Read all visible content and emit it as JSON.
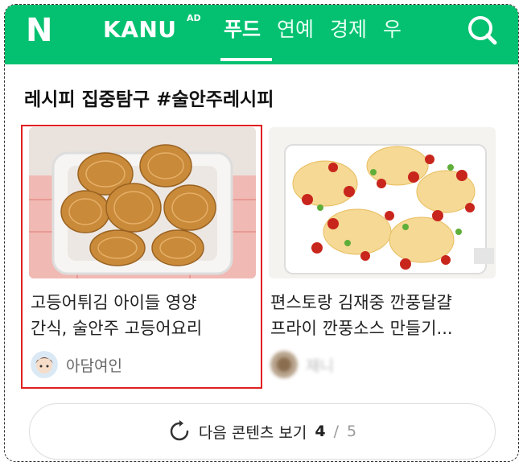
{
  "header": {
    "logo": "N",
    "brand": "KANU",
    "brand_sup": "AD",
    "nav": [
      {
        "label": "푸드",
        "active": true
      },
      {
        "label": "연예",
        "active": false
      },
      {
        "label": "경제",
        "active": false
      },
      {
        "label": "우",
        "active": false
      }
    ],
    "search_icon": "search-icon",
    "colors": {
      "brand_green": "#03c170"
    }
  },
  "section": {
    "title": "레시피 집중탐구 #술안주레시피"
  },
  "cards": [
    {
      "title_line1": "고등어튀김 아이들 영양",
      "title_line2": "간식, 술안주 고등어요리",
      "author": "아담여인",
      "highlighted": true
    },
    {
      "title_line1": "편스토랑 김재중 깐풍달걀",
      "title_line2": "프라이 깐풍소스 만들기...",
      "author": "재니"
    }
  ],
  "more": {
    "label": "다음 콘텐츠 보기",
    "page": "4",
    "separator": "/",
    "total": "5",
    "icon": "refresh-icon"
  },
  "colors": {
    "highlight": "#e02020"
  }
}
